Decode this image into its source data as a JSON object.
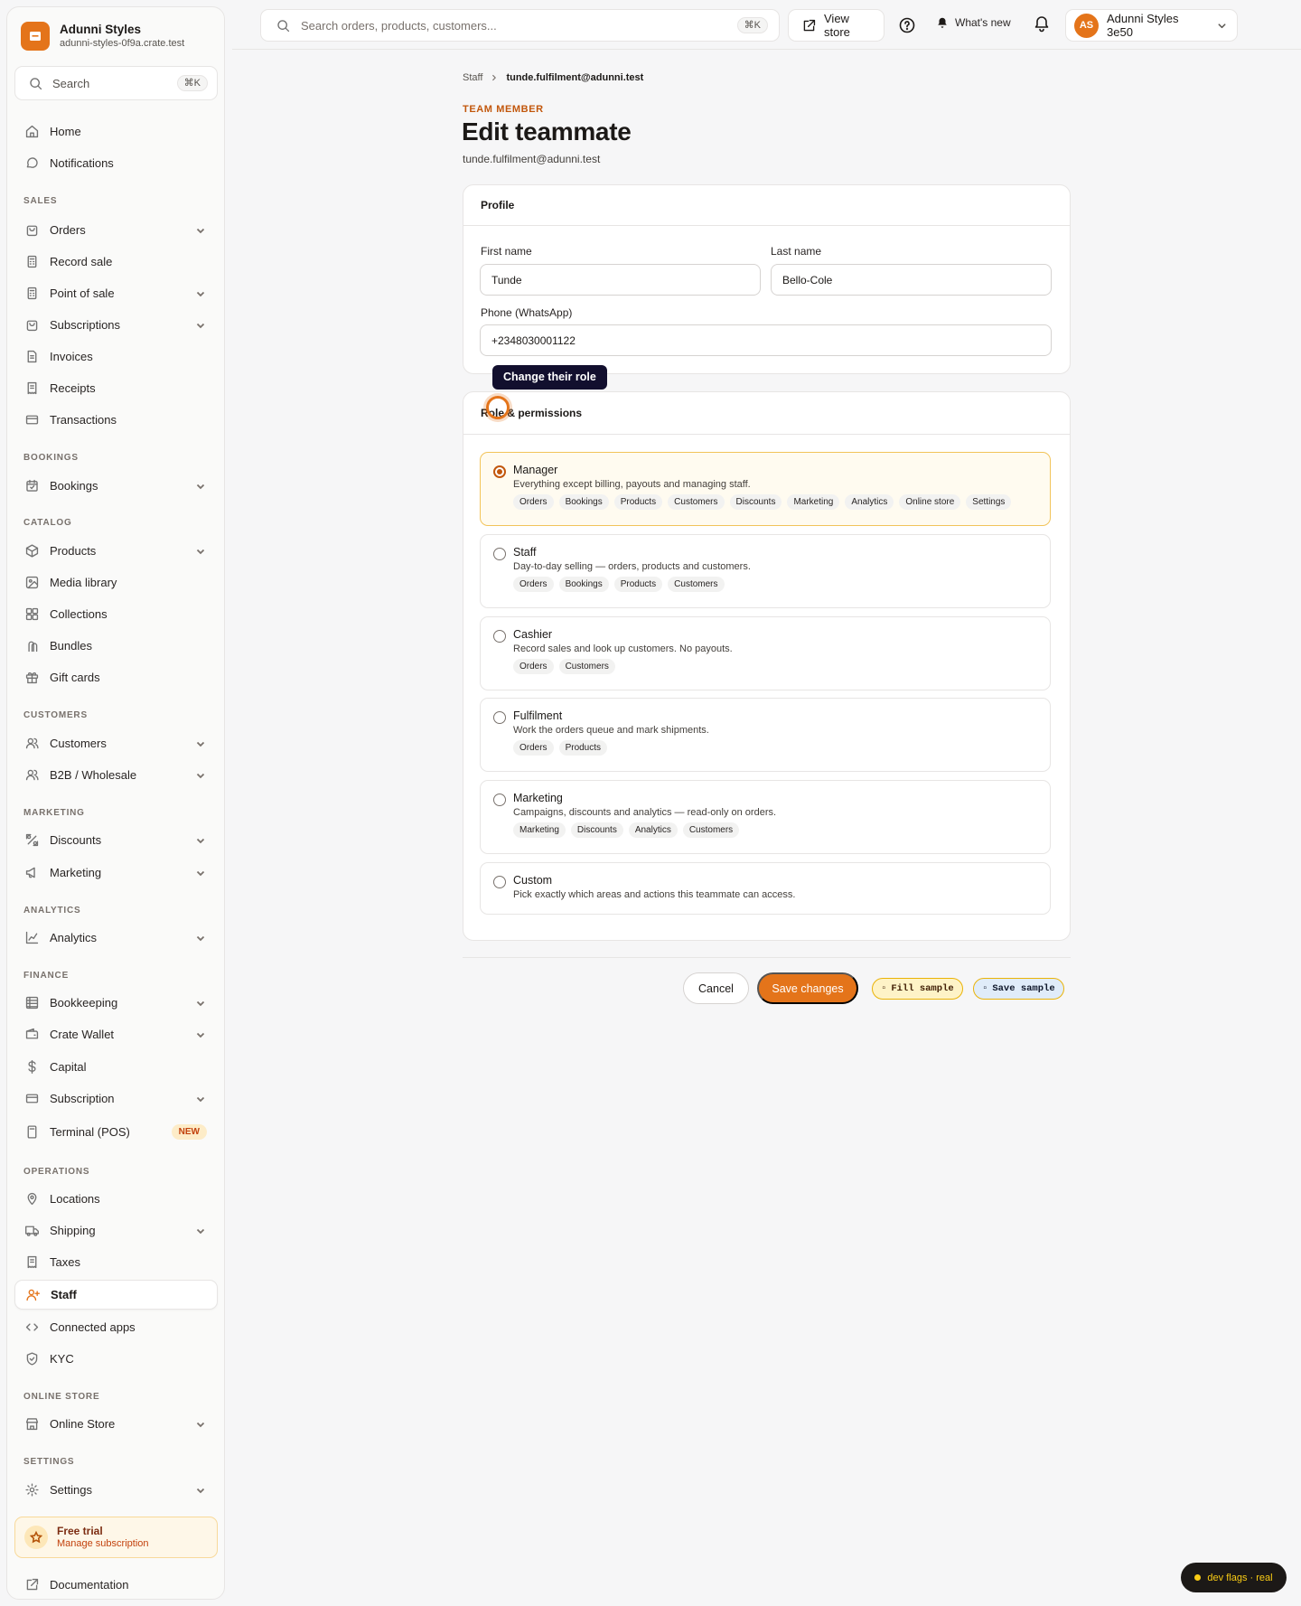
{
  "brand": {
    "name": "Adunni Styles",
    "domain": "adunni-styles-0f9a.crate.test"
  },
  "sidebar": {
    "search_placeholder": "Search",
    "search_shortcut": "⌘K",
    "home": "Home",
    "notifications": "Notifications",
    "sections": {
      "sales": "SALES",
      "bookings": "BOOKINGS",
      "catalog": "CATALOG",
      "customers": "CUSTOMERS",
      "marketing": "MARKETING",
      "analytics": "ANALYTICS",
      "finance": "FINANCE",
      "operations": "OPERATIONS",
      "online_store": "ONLINE STORE",
      "settings": "SETTINGS"
    },
    "items": {
      "orders": "Orders",
      "record_sale": "Record sale",
      "point_of_sale": "Point of sale",
      "subscriptions": "Subscriptions",
      "invoices": "Invoices",
      "receipts": "Receipts",
      "transactions": "Transactions",
      "bookings": "Bookings",
      "products": "Products",
      "media_library": "Media library",
      "collections": "Collections",
      "bundles": "Bundles",
      "gift_cards": "Gift cards",
      "customers": "Customers",
      "b2b": "B2B / Wholesale",
      "discounts": "Discounts",
      "marketing": "Marketing",
      "analytics": "Analytics",
      "bookkeeping": "Bookkeeping",
      "crate_wallet": "Crate Wallet",
      "capital": "Capital",
      "subscription": "Subscription",
      "terminal": "Terminal (POS)",
      "locations": "Locations",
      "shipping": "Shipping",
      "taxes": "Taxes",
      "staff": "Staff",
      "connected_apps": "Connected apps",
      "kyc": "KYC",
      "online_store": "Online Store",
      "settings": "Settings"
    },
    "terminal_badge": "NEW",
    "trial": {
      "title": "Free trial",
      "link": "Manage subscription"
    },
    "documentation": "Documentation"
  },
  "topbar": {
    "search_placeholder": "Search orders, products, customers...",
    "search_shortcut": "⌘K",
    "view_store": "View store",
    "whats_new": "What's new",
    "account_initials": "AS",
    "account_name": "Adunni Styles 3e50"
  },
  "page": {
    "breadcrumb_parent": "Staff",
    "breadcrumb_current": "tunde.fulfilment@adunni.test",
    "eyebrow": "TEAM MEMBER",
    "title": "Edit teammate",
    "email": "tunde.fulfilment@adunni.test"
  },
  "profile": {
    "heading": "Profile",
    "first_name_label": "First name",
    "first_name": "Tunde",
    "last_name_label": "Last name",
    "last_name": "Bello-Cole",
    "phone_label": "Phone (WhatsApp)",
    "phone": "+2348030001122"
  },
  "tooltip": "Change their role",
  "roles": {
    "heading": "Role & permissions",
    "selected": "Manager",
    "options": [
      {
        "name": "Manager",
        "desc": "Everything except billing, payouts and managing staff.",
        "chips": [
          "Orders",
          "Bookings",
          "Products",
          "Customers",
          "Discounts",
          "Marketing",
          "Analytics",
          "Online store",
          "Settings"
        ]
      },
      {
        "name": "Staff",
        "desc": "Day-to-day selling — orders, products and customers.",
        "chips": [
          "Orders",
          "Bookings",
          "Products",
          "Customers"
        ]
      },
      {
        "name": "Cashier",
        "desc": "Record sales and look up customers. No payouts.",
        "chips": [
          "Orders",
          "Customers"
        ]
      },
      {
        "name": "Fulfilment",
        "desc": "Work the orders queue and mark shipments.",
        "chips": [
          "Orders",
          "Products"
        ]
      },
      {
        "name": "Marketing",
        "desc": "Campaigns, discounts and analytics — read-only on orders.",
        "chips": [
          "Marketing",
          "Discounts",
          "Analytics",
          "Customers"
        ]
      },
      {
        "name": "Custom",
        "desc": "Pick exactly which areas and actions this teammate can access.",
        "chips": []
      }
    ]
  },
  "actions": {
    "cancel": "Cancel",
    "save": "Save changes",
    "fill_sample": "Fill sample",
    "save_sample": "Save sample"
  },
  "dev_flags": "dev flags · real",
  "colors": {
    "accent": "#e4741a",
    "tooltip_bg": "#120f2e",
    "selected_role_bg": "#fffbf0"
  }
}
